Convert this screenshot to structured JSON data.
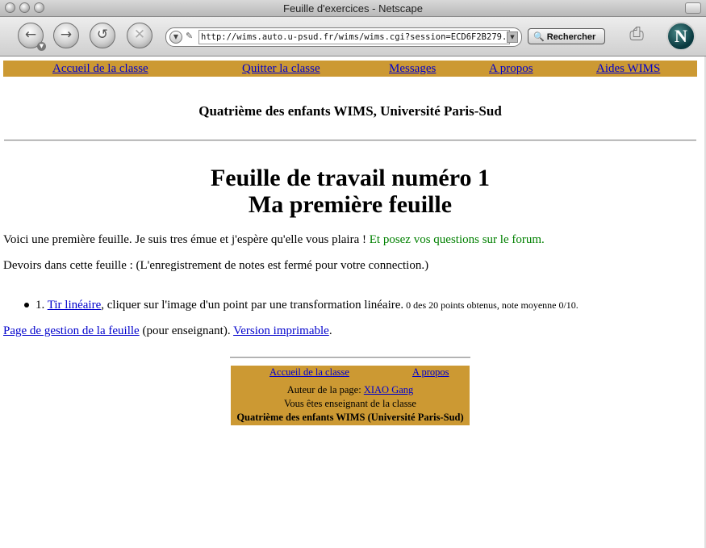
{
  "window": {
    "title": "Feuille d'exercices - Netscape"
  },
  "toolbar": {
    "url": "http://wims.auto.u-psud.fr/wims/wims.cgi?session=ECD6F2B279.6",
    "search_label": "Rechercher",
    "logo_letter": "N"
  },
  "menu": {
    "items": [
      "Accueil de la classe",
      "Quitter la classe",
      "Messages",
      "A propos",
      "Aides WIMS"
    ]
  },
  "page": {
    "class_title": "Quatrième des enfants WIMS, Université Paris-Sud",
    "sheet_title_line1": "Feuille de travail numéro 1",
    "sheet_title_line2": "Ma première feuille",
    "intro_text": "Voici une première feuille. Je suis tres émue et j'espère qu'elle vous plaira ! ",
    "intro_green": "Et posez vos questions sur le forum.",
    "homework_text": "Devoirs dans cette feuille : (L'enregistrement de notes est fermé pour votre connection.)",
    "exercise": {
      "number": "1.",
      "link": "Tir linéaire",
      "description": ", cliquer sur l'image d'un point par une transformation linéaire.",
      "score": " 0 des 20 points obtenus, note moyenne 0/10."
    },
    "management_link": "Page de gestion de la feuille",
    "management_middle": " (pour enseignant). ",
    "printable_link": "Version imprimable",
    "printable_end": "."
  },
  "footer": {
    "home_link": "Accueil de la classe",
    "about_link": "A propos",
    "author_label": "Auteur de la page: ",
    "author_name": "XIAO Gang",
    "teacher_text": "Vous êtes enseignant de la classe",
    "class_name": "Quatrième des enfants WIMS (Université Paris-Sud)"
  }
}
